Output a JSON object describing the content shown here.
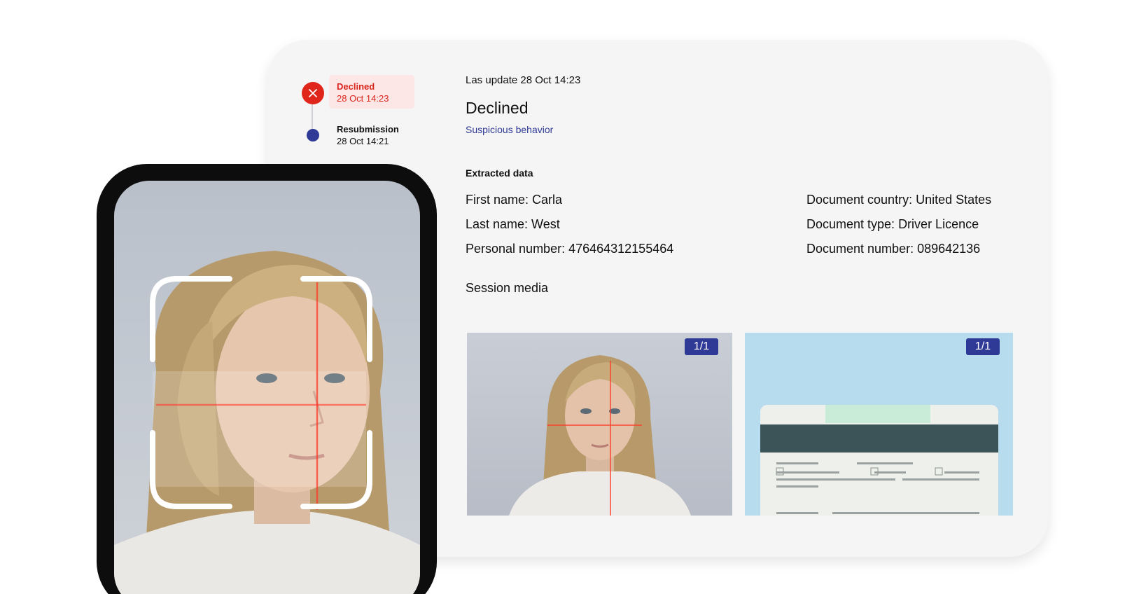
{
  "timeline": [
    {
      "title": "Declined",
      "time": "28 Oct 14:23",
      "status": "declined"
    },
    {
      "title": "Resubmission",
      "time": "28 Oct 14:21",
      "status": "resubmission"
    }
  ],
  "details": {
    "last_update": "Las update 28 Oct 14:23",
    "status_title": "Declined",
    "status_reason": "Suspicious behavior",
    "extracted_label": "Extracted data",
    "fields_left": [
      "First name: Carla",
      "Last name: West",
      "Personal number: 476464312155464"
    ],
    "fields_right": [
      "Document country: United States",
      "Document type: Driver Licence",
      "Document number: 089642136"
    ],
    "session_media_label": "Session media"
  },
  "media": [
    {
      "type": "face-photo",
      "page": "1/1"
    },
    {
      "type": "driver-licence-back",
      "page": "1/1"
    }
  ],
  "colors": {
    "declined_red": "#e0251b",
    "declined_bg": "#fde6e6",
    "accent_blue": "#2e3a96",
    "card_bg": "#f6f5f5"
  }
}
